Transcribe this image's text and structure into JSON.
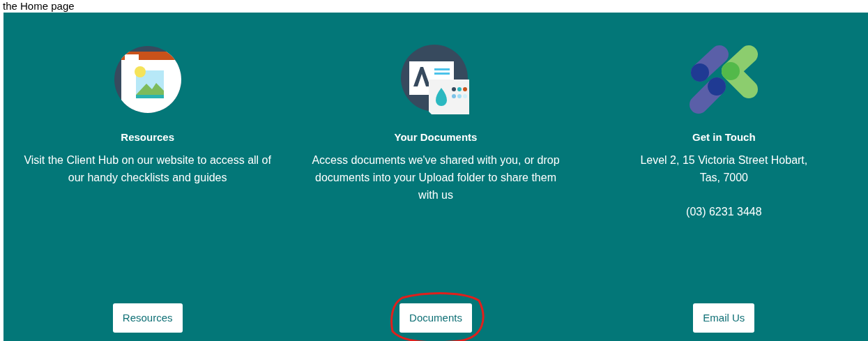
{
  "caption": "the Home page",
  "columns": [
    {
      "kind": "picture",
      "title": "Resources",
      "lines": [
        "Visit the Client Hub on our website to access all of our handy checklists and guides"
      ],
      "button": "Resources"
    },
    {
      "kind": "documents",
      "title": "Your Documents",
      "lines": [
        "Access documents we've shared with you, or drop documents into your Upload folder to share them with us"
      ],
      "button": "Documents",
      "annotation": {
        "kind": "circle"
      }
    },
    {
      "kind": "logo",
      "title": "Get in Touch",
      "lines": [
        "Level 2, 15 Victoria Street Hobart, Tas, 7000",
        "(03) 6231 3448"
      ],
      "button": "Email Us"
    }
  ]
}
